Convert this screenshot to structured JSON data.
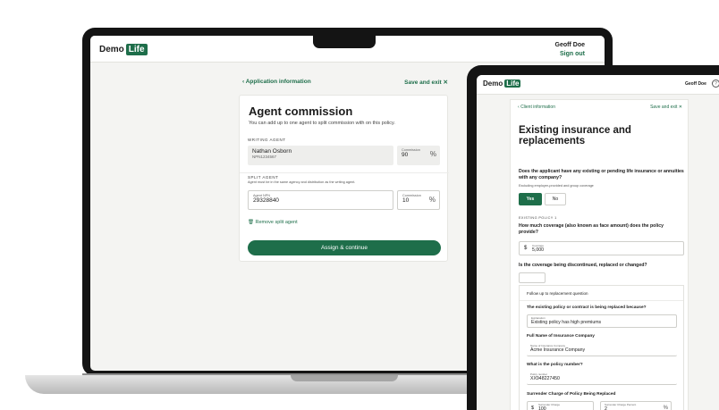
{
  "brand": {
    "demo": "Demo",
    "life": "Life",
    "accent": "#1e6e4a"
  },
  "laptop": {
    "user": {
      "name": "Geoff Doe",
      "sign_out": "Sign out"
    },
    "back_label": "Application information",
    "save_exit": "Save and exit",
    "title": "Agent commission",
    "subtitle": "You can add up to one agent to split commission with on this policy.",
    "writing_agent": {
      "section": "WRITING AGENT",
      "name": "Nathan Osborn",
      "npn": "NPN1234567",
      "commission_label": "Commission",
      "commission_value": "90",
      "pct": "%"
    },
    "split_agent": {
      "section": "SPLIT AGENT",
      "hint": "Agent must be in the same agency and distribution as the writing agent.",
      "npn_label": "Agent NPN",
      "npn_value": "29328840",
      "commission_label": "Commission",
      "commission_value": "10",
      "pct": "%",
      "remove": "Remove split agent"
    },
    "button": "Assign & continue"
  },
  "tablet": {
    "user": "Geoff Doe",
    "help": "?",
    "back_label": "Client information",
    "save_exit": "Save and exit",
    "title": "Existing insurance and replacements",
    "q1": "Does the applicant have any existing or pending life insurance or annuities with any company?",
    "q1_hint": "Excluding employer-provided and group coverage",
    "yes": "Yes",
    "no": "No",
    "section": "EXISTING POLICY 1",
    "q2": "How much coverage (also known as face amount) does the policy provide?",
    "coverage_label": "Coverage",
    "coverage_currency": "$",
    "coverage_value": "5,000",
    "q3": "Is the coverage being discontinued, replaced or changed?",
    "follow_up": {
      "header": "Follow up to replacement question",
      "q_reason": "The existing policy or contract is being replaced because?",
      "explanation_label": "Explanation",
      "explanation_value": "Existing policy has high premiums",
      "q_company": "Full Name of Insurance Company",
      "company_label": "Name of Insurance Company",
      "company_value": "Acme Insurance Company",
      "q_policy": "What is the policy number?",
      "policy_label": "Policy number",
      "policy_value": "XX948227450",
      "q_surrender": "Surrender Charge of Policy Being Replaced",
      "charge_label": "Surrender Charge",
      "charge_currency": "$",
      "charge_value": "100",
      "charge_pct_label": "Surrender Charge Percent",
      "charge_pct_value": "2",
      "pct": "%"
    }
  }
}
